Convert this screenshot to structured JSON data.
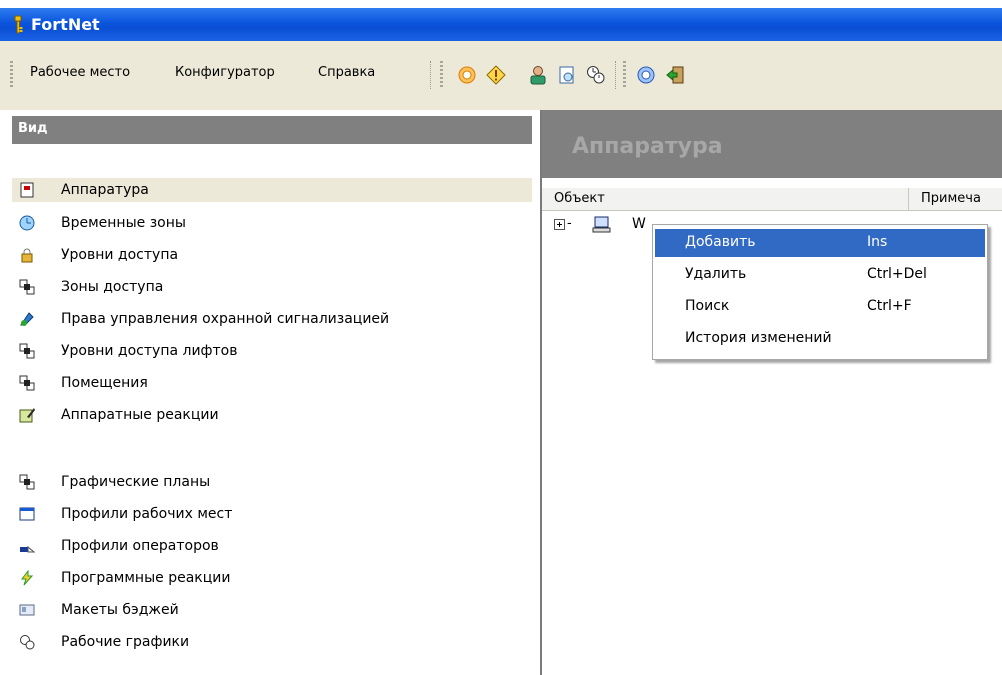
{
  "window": {
    "title": "FortNet"
  },
  "menu": [
    {
      "label": "Рабочее место"
    },
    {
      "label": "Конфигуратор"
    },
    {
      "label": "Справка"
    }
  ],
  "toolbar_icons": [
    "gear-sun-icon",
    "diamond-warning-icon",
    "operator-icon",
    "document-icon",
    "schedule-icon",
    "help-icon",
    "exit-icon"
  ],
  "left": {
    "header": "Вид",
    "items": [
      {
        "label": "Аппаратура",
        "icon": "device-icon",
        "selected": true
      },
      {
        "label": "Временные зоны",
        "icon": "clock-icon"
      },
      {
        "label": "Уровни доступа",
        "icon": "lock-icon"
      },
      {
        "label": "Зоны доступа",
        "icon": "zones-icon"
      },
      {
        "label": "Права управления охранной сигнализацией",
        "icon": "alarm-rights-icon"
      },
      {
        "label": "Уровни доступа лифтов",
        "icon": "zones-icon"
      },
      {
        "label": "Помещения",
        "icon": "zones-icon"
      },
      {
        "label": "Аппаратные реакции",
        "icon": "reactions-icon"
      },
      {
        "label": "Графические планы",
        "icon": "zones-icon"
      },
      {
        "label": "Профили рабочих мест",
        "icon": "window-icon"
      },
      {
        "label": "Профили операторов",
        "icon": "operator-profile-icon"
      },
      {
        "label": "Программные реакции",
        "icon": "lightning-icon"
      },
      {
        "label": "Макеты бэджей",
        "icon": "badge-icon"
      },
      {
        "label": "Рабочие графики",
        "icon": "schedule-icon"
      }
    ]
  },
  "right": {
    "header": "Аппаратура",
    "columns": [
      "Объект",
      "Примеча"
    ],
    "tree_row_label": "W"
  },
  "context_menu": [
    {
      "label": "Добавить",
      "shortcut": "Ins",
      "highlighted": true
    },
    {
      "label": "Удалить",
      "shortcut": "Ctrl+Del"
    },
    {
      "label": "Поиск",
      "shortcut": "Ctrl+F"
    },
    {
      "label": "История изменений",
      "shortcut": ""
    }
  ],
  "colors": {
    "title_bar": "#0a55dd",
    "highlight": "#316ac5",
    "panel_gray": "#808080",
    "toolbar_bg": "#ece9d8"
  }
}
